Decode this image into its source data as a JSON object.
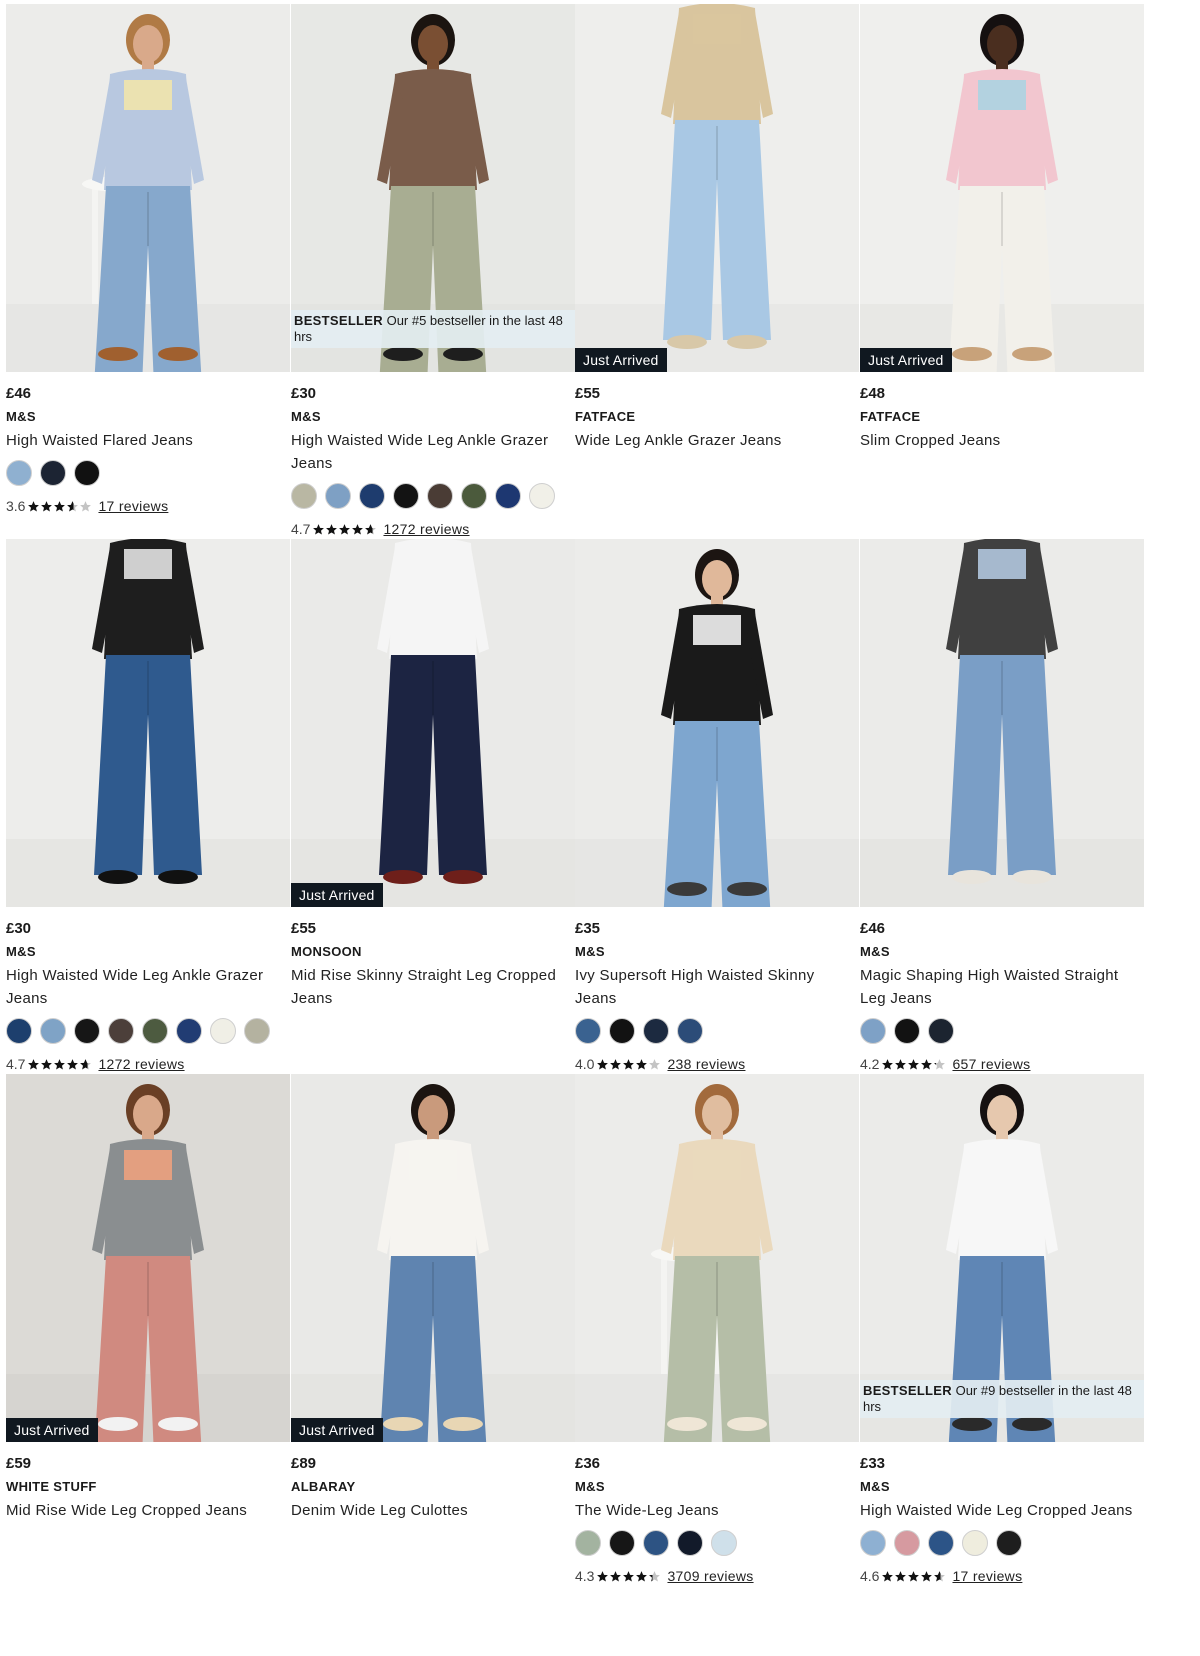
{
  "products": [
    {
      "price": "£46",
      "brand": "M&S",
      "name": "High Waisted Flared Jeans",
      "badge": "",
      "bestseller": null,
      "swatches": [
        "#8fb0d0",
        "#1c2433",
        "#111111"
      ],
      "rating": "3.6",
      "rating_value": 3.6,
      "reviews": "17 reviews",
      "photo": {
        "bg": "#ececea",
        "floor": "#e6e6e4",
        "skin": "#d9a98a",
        "hair": "#b07a45",
        "top": "#b8c8e0",
        "accent": "#f3e6a8",
        "pants": "#86a8cc",
        "shoes": "#a0602f",
        "pose": "sit"
      }
    },
    {
      "price": "£30",
      "brand": "M&S",
      "name": "High Waisted Wide Leg Ankle Grazer Jeans",
      "badge": "",
      "bestseller": {
        "label": "BESTSELLER",
        "text": "Our #5 bestseller in the last 48 hrs"
      },
      "swatches": [
        "#b9b7a3",
        "#7ea0c4",
        "#1e3c6e",
        "#131313",
        "#4a3c35",
        "#4b5a3c",
        "#1d3771",
        "#f1f0e8"
      ],
      "rating": "4.7",
      "rating_value": 4.7,
      "reviews": "1272 reviews",
      "photo": {
        "bg": "#e7e8e5",
        "floor": "#e3e4e1",
        "skin": "#7a4f33",
        "hair": "#1b1410",
        "top": "#7a5c4a",
        "accent": "#7a5c4a",
        "pants": "#a8ad92",
        "shoes": "#1e1e1e",
        "pose": "stand"
      }
    },
    {
      "price": "£55",
      "brand": "FATFACE",
      "name": "Wide Leg Ankle Grazer Jeans",
      "badge": "Just Arrived",
      "bestseller": null,
      "swatches": [],
      "rating": "",
      "rating_value": 0,
      "reviews": "",
      "photo": {
        "bg": "#eeeeec",
        "floor": "#e8e8e6",
        "skin": "#7a5035",
        "hair": "#1b1410",
        "top": "#d9c59e",
        "accent": "#d9c59e",
        "pants": "#a9c8e4",
        "shoes": "#d8c8a8",
        "pose": "crop"
      }
    },
    {
      "price": "£48",
      "brand": "FATFACE",
      "name": "Slim Cropped Jeans",
      "badge": "Just Arrived",
      "bestseller": null,
      "swatches": [],
      "rating": "",
      "rating_value": 0,
      "reviews": "",
      "photo": {
        "bg": "#efefed",
        "floor": "#e8e8e5",
        "skin": "#4a2e1f",
        "hair": "#151010",
        "top": "#f2c6cf",
        "accent": "#a8d3e3",
        "pants": "#f2f0ea",
        "shoes": "#c8a27a",
        "pose": "stand"
      }
    },
    {
      "price": "£30",
      "brand": "M&S",
      "name": "High Waisted Wide Leg Ankle Grazer Jeans",
      "badge": "",
      "bestseller": null,
      "swatches": [
        "#1d3f6d",
        "#7fa3c6",
        "#161616",
        "#4c3f3a",
        "#4d5b40",
        "#213c73",
        "#f0efe6",
        "#b4b2a0"
      ],
      "rating": "4.7",
      "rating_value": 4.7,
      "reviews": "1272 reviews",
      "photo": {
        "bg": "#ededeb",
        "floor": "#e6e6e3",
        "skin": "#d8b090",
        "hair": "#2a2a2a",
        "top": "#1e1e1e",
        "accent": "#eeeeee",
        "pants": "#2f5a8e",
        "shoes": "#111111",
        "pose": "crop"
      }
    },
    {
      "price": "£55",
      "brand": "MONSOON",
      "name": "Mid Rise Skinny Straight Leg Cropped Jeans",
      "badge": "Just Arrived",
      "bestseller": null,
      "swatches": [],
      "rating": "",
      "rating_value": 0,
      "reviews": "",
      "photo": {
        "bg": "#eaeae8",
        "floor": "#e5e5e2",
        "skin": "#e1c1a8",
        "hair": "#3a2a20",
        "top": "#f5f5f5",
        "accent": "#f5f5f5",
        "pants": "#1c2442",
        "shoes": "#6e1f1a",
        "pose": "crop"
      }
    },
    {
      "price": "£35",
      "brand": "M&S",
      "name": "Ivy Supersoft High Waisted Skinny Jeans",
      "badge": "",
      "bestseller": null,
      "swatches": [
        "#3a6290",
        "#121212",
        "#1c2a40",
        "#2c4c78"
      ],
      "rating": "4.0",
      "rating_value": 4.0,
      "reviews": "238 reviews",
      "photo": {
        "bg": "#ececea",
        "floor": "#e6e6e4",
        "skin": "#e0b89a",
        "hair": "#1c1512",
        "top": "#1a1a1a",
        "accent": "#ffffff",
        "pants": "#7ea6cf",
        "shoes": "#3a3a3a",
        "pose": "stand"
      }
    },
    {
      "price": "£46",
      "brand": "M&S",
      "name": "Magic Shaping High Waisted Straight Leg Jeans",
      "badge": "",
      "bestseller": null,
      "swatches": [
        "#7ea1c6",
        "#121212",
        "#1c2430"
      ],
      "rating": "4.2",
      "rating_value": 4.2,
      "reviews": "657 reviews",
      "photo": {
        "bg": "#ebebe9",
        "floor": "#e5e5e2",
        "skin": "#e2c0a6",
        "hair": "#3b2c22",
        "top": "#404040",
        "accent": "#b9cfe8",
        "pants": "#7a9ec6",
        "shoes": "#e8e4dc",
        "pose": "crop"
      }
    },
    {
      "price": "£59",
      "brand": "WHITE STUFF",
      "name": "Mid Rise Wide Leg Cropped Jeans",
      "badge": "Just Arrived",
      "bestseller": null,
      "swatches": [],
      "rating": "",
      "rating_value": 0,
      "reviews": "",
      "photo": {
        "bg": "#dcdad6",
        "floor": "#d6d4d0",
        "skin": "#d9a88a",
        "hair": "#6a3f25",
        "top": "#8a8e90",
        "accent": "#f2a27e",
        "pants": "#d08a80",
        "shoes": "#f2f2f2",
        "pose": "stand"
      }
    },
    {
      "price": "£89",
      "brand": "ALBARAY",
      "name": "Denim Wide Leg Culottes",
      "badge": "Just Arrived",
      "bestseller": null,
      "swatches": [],
      "rating": "",
      "rating_value": 0,
      "reviews": "",
      "photo": {
        "bg": "#e9e9e7",
        "floor": "#e4e4e1",
        "skin": "#c99a7c",
        "hair": "#1c1410",
        "top": "#f6f4f0",
        "accent": "#f6f4f0",
        "pants": "#5f84b0",
        "shoes": "#e8d6b4",
        "pose": "stand"
      }
    },
    {
      "price": "£36",
      "brand": "M&S",
      "name": "The Wide-Leg Jeans",
      "badge": "",
      "bestseller": null,
      "swatches": [
        "#a3b3a0",
        "#161616",
        "#2d5383",
        "#121a2a",
        "#cfe0ea"
      ],
      "rating": "4.3",
      "rating_value": 4.3,
      "reviews": "3709 reviews",
      "photo": {
        "bg": "#ececea",
        "floor": "#e6e6e4",
        "skin": "#e0bd9f",
        "hair": "#a26a3c",
        "top": "#ead9bd",
        "accent": "#ead9bd",
        "pants": "#b5bea7",
        "shoes": "#efe6d6",
        "pose": "sit"
      }
    },
    {
      "price": "£33",
      "brand": "M&S",
      "name": "High Waisted Wide Leg Cropped Jeans",
      "badge": "",
      "bestseller": {
        "label": "BESTSELLER",
        "text": "Our #9 bestseller in the last 48 hrs"
      },
      "swatches": [
        "#8eb0d2",
        "#d69aa0",
        "#2c5487",
        "#efedde",
        "#1e1e1e"
      ],
      "rating": "4.6",
      "rating_value": 4.6,
      "reviews": "17 reviews",
      "photo": {
        "bg": "#ebebe9",
        "floor": "#e6e6e3",
        "skin": "#e6c8ae",
        "hair": "#161111",
        "top": "#f7f7f7",
        "accent": "#f7f7f7",
        "pants": "#5f86b5",
        "shoes": "#2a2a2a",
        "pose": "stand"
      }
    }
  ]
}
